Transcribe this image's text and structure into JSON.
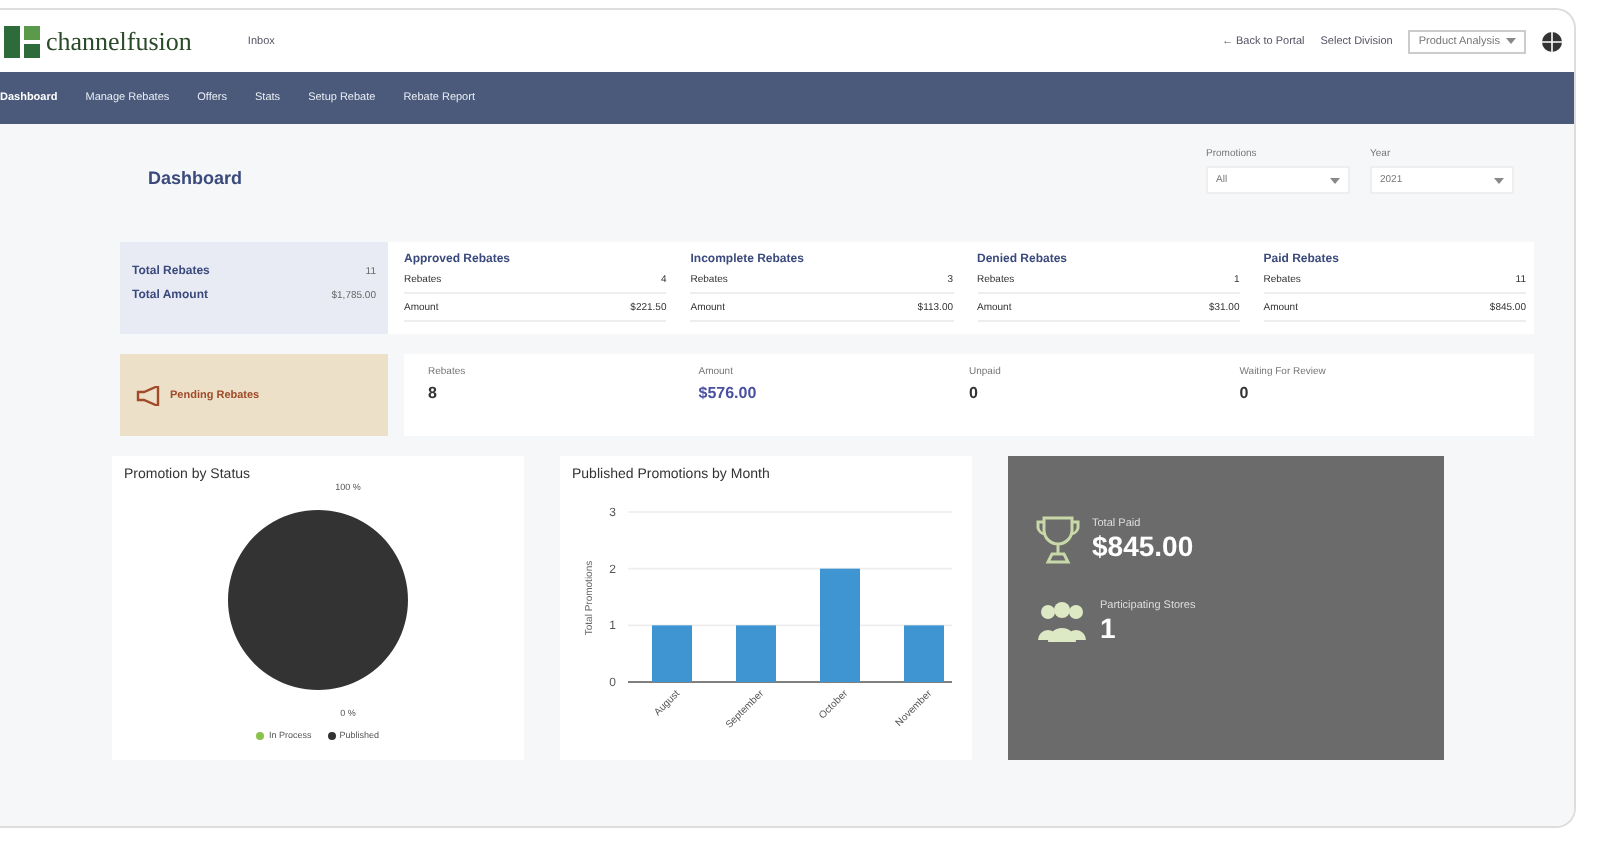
{
  "header": {
    "logo": "channelfusion",
    "link": "Inbox",
    "back": "← Back to Portal",
    "division_label": "Select Division",
    "division": {
      "value": "Product Analysis"
    }
  },
  "nav": [
    {
      "label": "Dashboard",
      "selected": true
    },
    {
      "label": "Manage Rebates",
      "selected": false
    },
    {
      "label": "Offers",
      "selected": false
    },
    {
      "label": "Stats",
      "selected": false
    },
    {
      "label": "Setup Rebate",
      "selected": false
    },
    {
      "label": "Rebate Report",
      "selected": false
    }
  ],
  "page_title": "Dashboard",
  "filters": [
    {
      "label": "Promotions",
      "value": "All"
    },
    {
      "label": "Year",
      "value": "2021"
    }
  ],
  "totals": [
    {
      "label": "Total Rebates",
      "value": "11"
    },
    {
      "label": "Total Amount",
      "value": "$1,785.00"
    }
  ],
  "status_cards": [
    {
      "title": "Approved Rebates",
      "rows": [
        {
          "label": "Rebates",
          "value": "4"
        },
        {
          "label": "Amount",
          "value": "$221.50"
        }
      ]
    },
    {
      "title": "Incomplete Rebates",
      "rows": [
        {
          "label": "Rebates",
          "value": "3"
        },
        {
          "label": "Amount",
          "value": "$113.00"
        }
      ]
    },
    {
      "title": "Denied Rebates",
      "rows": [
        {
          "label": "Rebates",
          "value": "1"
        },
        {
          "label": "Amount",
          "value": "$31.00"
        }
      ]
    },
    {
      "title": "Paid Rebates",
      "rows": [
        {
          "label": "Rebates",
          "value": "11"
        },
        {
          "label": "Amount",
          "value": "$845.00"
        }
      ]
    }
  ],
  "pending": {
    "title": "Pending Rebates",
    "stats": [
      {
        "label": "Rebates",
        "value": "8",
        "accent": false
      },
      {
        "label": "Amount",
        "value": "$576.00",
        "accent": true
      },
      {
        "label": "Unpaid",
        "value": "0",
        "accent": false
      },
      {
        "label": "Waiting For Review",
        "value": "0",
        "accent": false
      }
    ]
  },
  "pie": {
    "title": "Promotion by Status",
    "top_label": "100 %",
    "bottom_label": "0 %",
    "chart_data": {
      "type": "pie",
      "categories": [
        "In Process",
        "Published"
      ],
      "values": [
        0,
        100
      ]
    },
    "legend": [
      {
        "color": "#8bc34a"
      },
      {
        "color": "#333333"
      }
    ]
  },
  "bar": {
    "title": "Published Promotions by Month",
    "chart_data": {
      "type": "bar",
      "ylabel": "Total Promotions",
      "categories": [
        "August",
        "September",
        "October",
        "November"
      ],
      "values": [
        1,
        1,
        2,
        1
      ],
      "yticks": [
        0,
        1,
        2,
        3
      ],
      "ylim": [
        0,
        3
      ]
    }
  },
  "summary": [
    {
      "kind": "trophy",
      "label": "Total Paid",
      "value": "$845.00"
    },
    {
      "kind": "people",
      "label": "Participating Stores",
      "value": "1"
    }
  ]
}
